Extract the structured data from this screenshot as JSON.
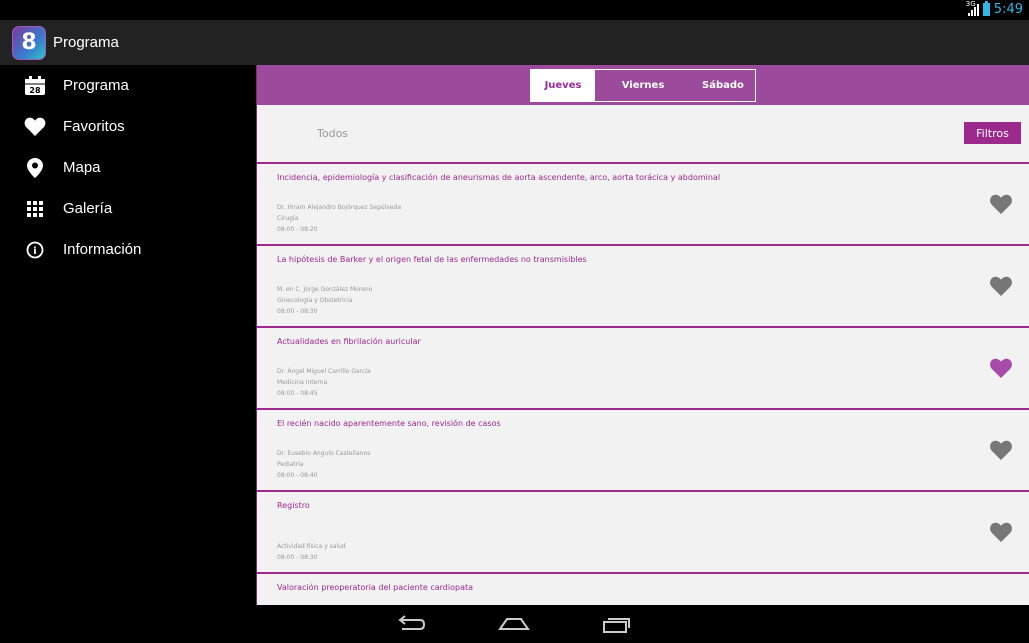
{
  "status_bar": {
    "network": "3G",
    "time": "5:49"
  },
  "app": {
    "title": "Programa"
  },
  "sidebar": {
    "items": [
      {
        "label": "Programa",
        "icon": "calendar-icon",
        "icon_text": "28"
      },
      {
        "label": "Favoritos",
        "icon": "heart-icon"
      },
      {
        "label": "Mapa",
        "icon": "map-pin-icon"
      },
      {
        "label": "Galería",
        "icon": "grid-icon"
      },
      {
        "label": "Información",
        "icon": "info-icon",
        "icon_text": "i"
      }
    ]
  },
  "tabs": [
    {
      "label": "Jueves",
      "active": true
    },
    {
      "label": "Viernes",
      "active": false
    },
    {
      "label": "Sábado",
      "active": false
    }
  ],
  "filter": {
    "current": "Todos",
    "button_label": "Filtros"
  },
  "sessions": [
    {
      "title": "Incidencia, epidemiología y clasificación de aneurismas de aorta ascendente, arco, aorta torácica y abdominal",
      "speaker": "Dr. Hiram Alejandro Bojórquez Sepúlveda",
      "specialty": "Cirugía",
      "time": "08:00 - 08:20",
      "favorite": false
    },
    {
      "title": "La hipótesis de Barker y el origen fetal de las enfermedades no transmisibles",
      "speaker": "M. en C. Jorge González Moreno",
      "specialty": "Ginecología y Obstetricia",
      "time": "08:00 - 08:30",
      "favorite": false
    },
    {
      "title": "Actualidades en fibrilación auricular",
      "speaker": "Dr. Ángel Miguel Carrillo García",
      "specialty": "Medicina Interna",
      "time": "08:00 - 08:45",
      "favorite": true
    },
    {
      "title": "El recién nacido aparentemente sano, revisión de casos",
      "speaker": "Dr. Eusebio Angulo Castellanos",
      "specialty": "Pediatría",
      "time": "08:00 - 08:40",
      "favorite": false
    },
    {
      "title": "Registro",
      "speaker": "",
      "specialty": "Actividad física y salud",
      "time": "08:00 - 08:30",
      "favorite": false
    },
    {
      "title": "Valoración preoperatoria del paciente cardiopata",
      "speaker": "",
      "specialty": "",
      "time": "",
      "favorite": false
    }
  ],
  "colors": {
    "accent": "#9b2a8c",
    "tab_bar": "#9b4a9c",
    "heart_off": "#777777",
    "heart_on": "#a84aa8",
    "status": "#33b5e5"
  }
}
